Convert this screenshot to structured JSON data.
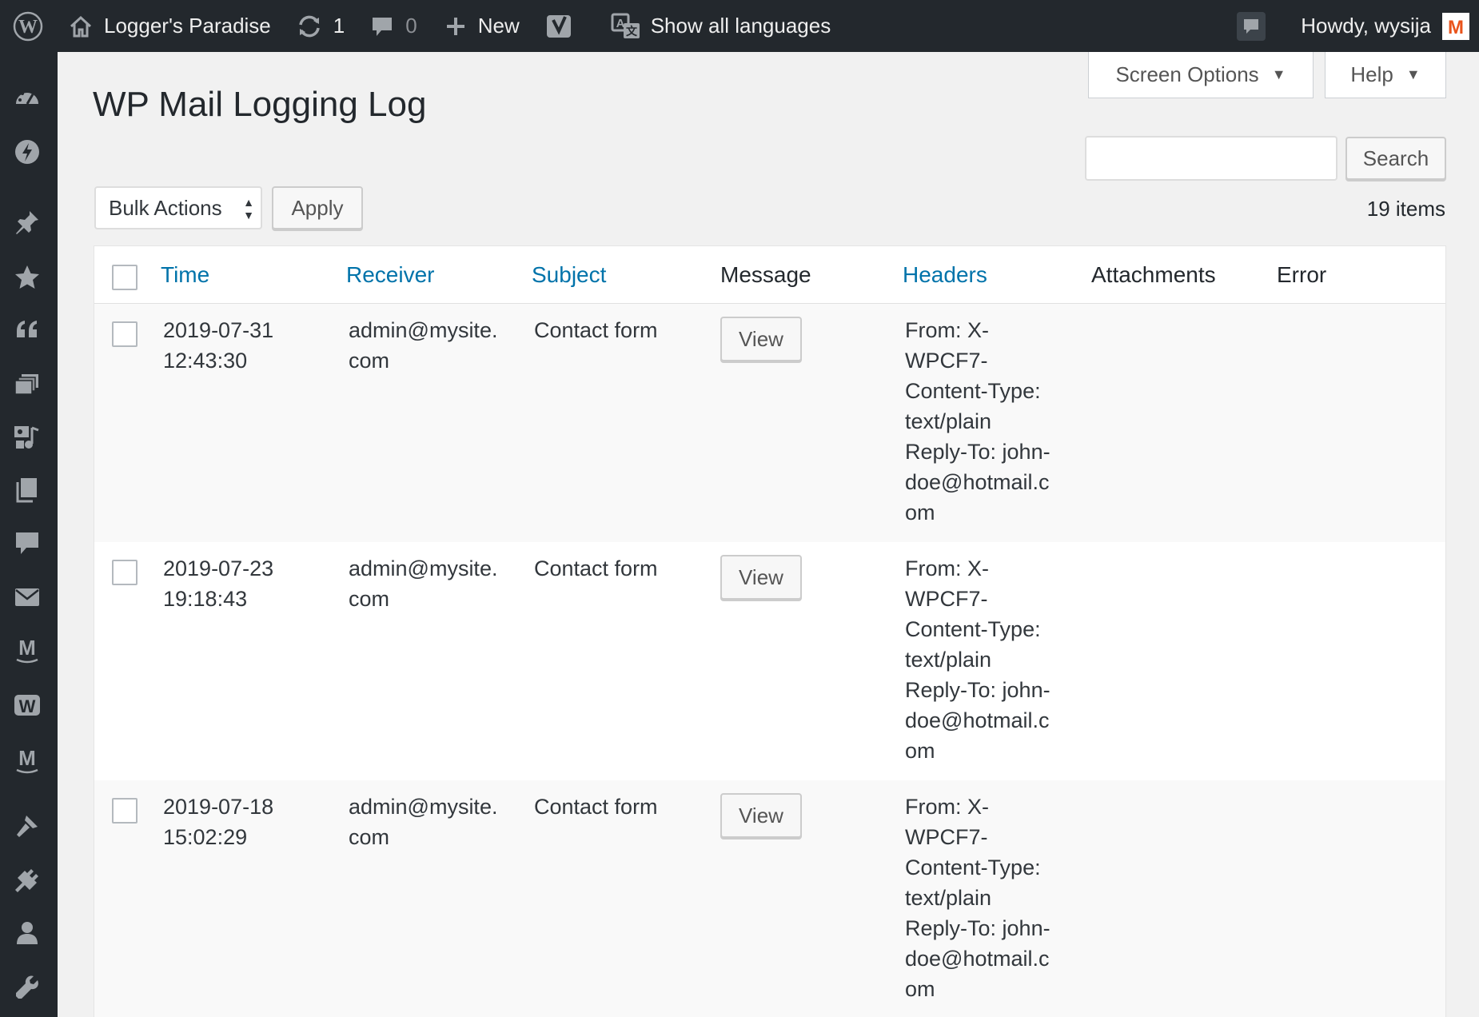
{
  "adminbar": {
    "site_name": "Logger's Paradise",
    "updates_count": "1",
    "comments_count": "0",
    "new_label": "New",
    "languages_label": "Show all languages",
    "howdy": "Howdy, wysija"
  },
  "sidebar": {
    "icons": [
      "dashboard-icon",
      "activity-icon",
      "posts-pin-icon",
      "star-icon",
      "quotes-icon",
      "gallery-icon",
      "media-icon",
      "pages-icon",
      "comments-icon",
      "mail-icon",
      "mailpoet-icon",
      "woocommerce-icon",
      "mailpoet-alt-icon",
      "appearance-icon",
      "plugins-icon",
      "users-icon",
      "tools-icon"
    ]
  },
  "page": {
    "title": "WP Mail Logging Log",
    "screen_options": "Screen Options",
    "help": "Help",
    "search_button": "Search",
    "bulk_actions": "Bulk Actions",
    "apply": "Apply",
    "items_count": "19 items"
  },
  "table": {
    "headers": {
      "time": "Time",
      "receiver": "Receiver",
      "subject": "Subject",
      "message": "Message",
      "headers": "Headers",
      "attachments": "Attachments",
      "error": "Error"
    },
    "rows": [
      {
        "date": "2019-07-31",
        "time": "12:43:30",
        "receiver_line1": "admin@mysite.",
        "receiver_line2": "com",
        "subject": "Contact form",
        "view": "View",
        "headers_text": "From: X-\nWPCF7-\nContent-Type:\ntext/plain\nReply-To: john-\ndoe@hotmail.c\nom"
      },
      {
        "date": "2019-07-23",
        "time": "19:18:43",
        "receiver_line1": "admin@mysite.",
        "receiver_line2": "com",
        "subject": "Contact form",
        "view": "View",
        "headers_text": "From: X-\nWPCF7-\nContent-Type:\ntext/plain\nReply-To: john-\ndoe@hotmail.c\nom"
      },
      {
        "date": "2019-07-18",
        "time": "15:02:29",
        "receiver_line1": "admin@mysite.",
        "receiver_line2": "com",
        "subject": "Contact form",
        "view": "View",
        "headers_text": "From: X-\nWPCF7-\nContent-Type:\ntext/plain\nReply-To: john-\ndoe@hotmail.c\nom"
      }
    ]
  },
  "colors": {
    "adminbar_bg": "#23282d",
    "link": "#0073aa",
    "avatar_accent": "#e9541c"
  }
}
